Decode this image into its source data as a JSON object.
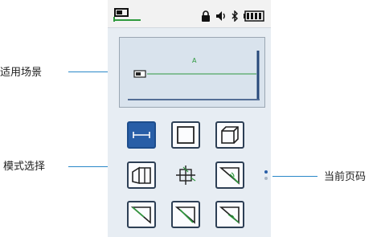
{
  "callouts": {
    "scene": "适用场景",
    "mode_select": "模式选择",
    "page_indicator": "当前页码"
  },
  "screen": {
    "measure_label": "A"
  },
  "modes": {
    "items": [
      {
        "name": "single-distance",
        "selected": true
      },
      {
        "name": "area",
        "selected": false
      },
      {
        "name": "volume",
        "selected": false
      },
      {
        "name": "wall-area",
        "selected": false
      },
      {
        "name": "pythagoras-height",
        "selected": false
      },
      {
        "name": "triangle-1",
        "selected": false
      },
      {
        "name": "triangle-2",
        "selected": false
      },
      {
        "name": "triangle-3",
        "selected": false
      },
      {
        "name": "triangle-4",
        "selected": false
      }
    ]
  },
  "page_dots": {
    "count": 2,
    "current": 1
  },
  "colors": {
    "accent_blue": "#285ea7",
    "line_green": "#2f9a3e",
    "callout_line": "#2a88c8"
  }
}
